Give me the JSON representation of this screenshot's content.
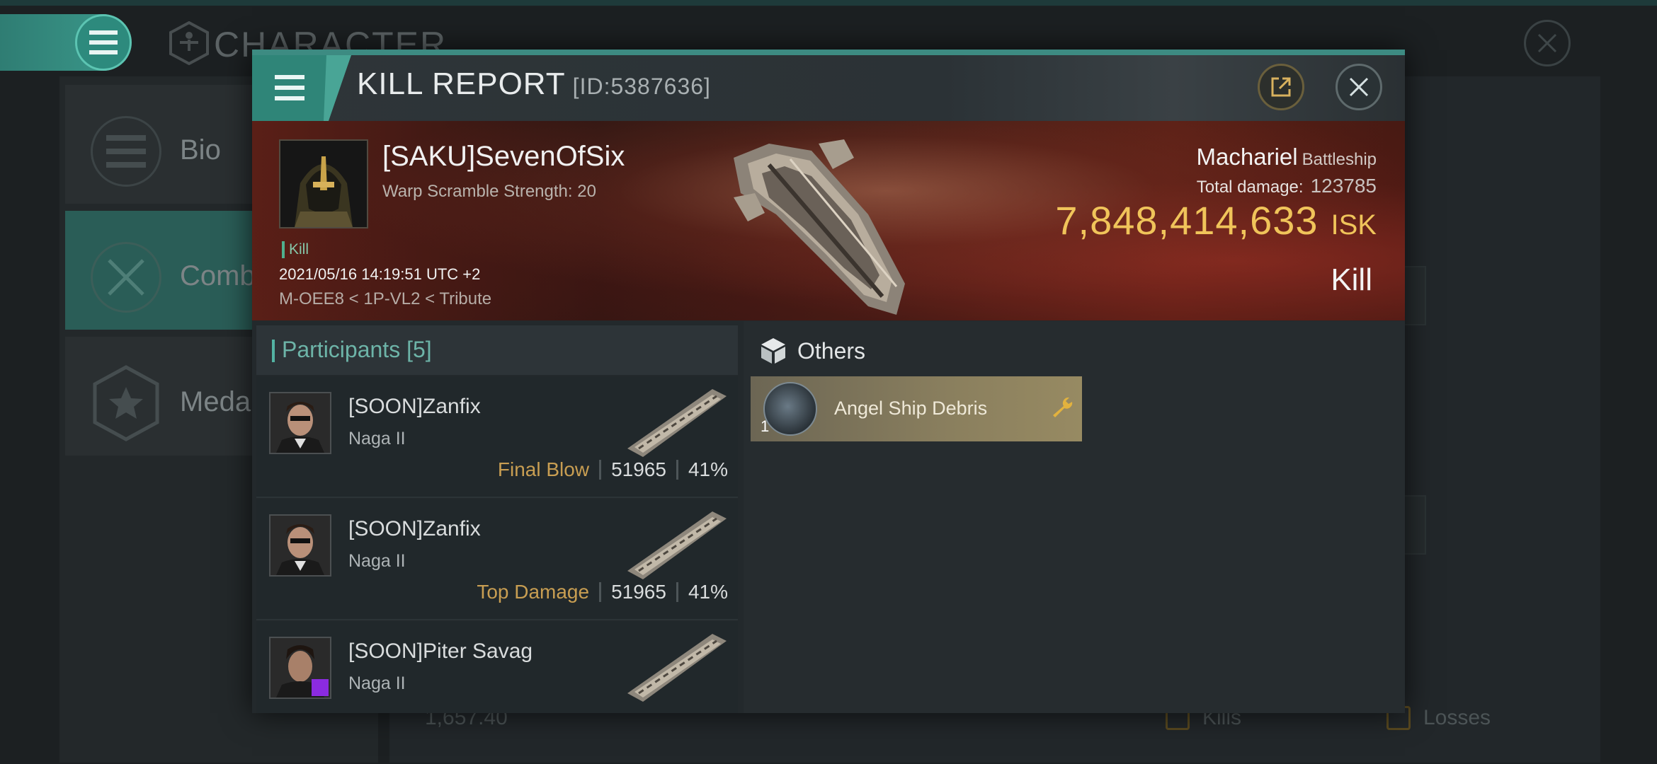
{
  "background": {
    "title": "CHARACTER",
    "sidebar": [
      {
        "label": "Bio",
        "icon": "list-icon"
      },
      {
        "label": "Comb",
        "icon": "crossed-swords-icon"
      },
      {
        "label": "Medal",
        "icon": "star-medal-icon"
      }
    ],
    "bottom_value": "1,657.40",
    "kills_label": "Kills",
    "losses_label": "Losses"
  },
  "kill_report": {
    "title": "KILL REPORT",
    "id": "[ID:5387636]",
    "victim": {
      "name": "[SAKU]SevenOfSix",
      "subtitle": "Warp Scramble Strength: 20",
      "tag": "Kill",
      "datetime": "2021/05/16 14:19:51 UTC +2",
      "location": "M-OEE8 < 1P-VL2 < Tribute"
    },
    "ship": {
      "name": "Machariel",
      "class": "Battleship",
      "total_damage_label": "Total damage:",
      "total_damage": "123785",
      "isk_value": "7,848,414,633",
      "isk_unit": "ISK",
      "result": "Kill"
    },
    "participants": {
      "label": "Participants",
      "count": "[5]",
      "rows": [
        {
          "name": "[SOON]Zanfix",
          "ship": "Naga II",
          "label": "Final Blow",
          "damage": "51965",
          "percent": "41%"
        },
        {
          "name": "[SOON]Zanfix",
          "ship": "Naga II",
          "label": "Top Damage",
          "damage": "51965",
          "percent": "41%"
        },
        {
          "name": "[SOON]Piter Savag",
          "ship": "Naga II",
          "label": "",
          "damage": "",
          "percent": ""
        }
      ]
    },
    "others": {
      "label": "Others",
      "items": [
        {
          "name": "Angel Ship Debris",
          "qty": "1",
          "icon": "wrench-icon"
        }
      ]
    }
  },
  "colors": {
    "accent": "#3d8b82",
    "isk": "#f0c45a",
    "label_gold": "#c89e52",
    "participants_header": "#6db4a8"
  }
}
